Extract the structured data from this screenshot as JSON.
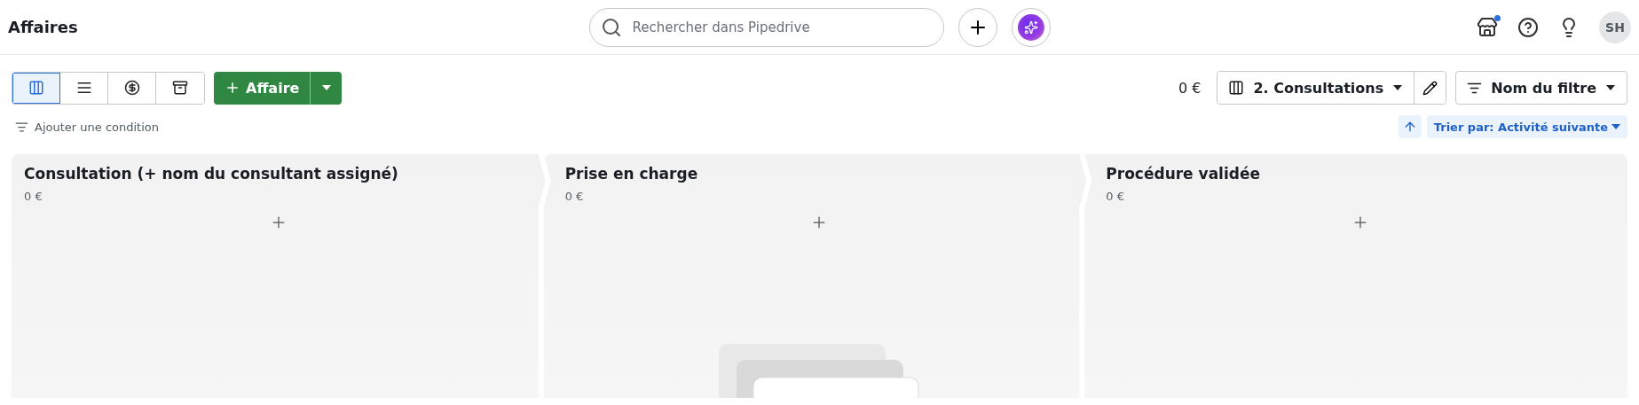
{
  "header": {
    "title": "Affaires",
    "search": {
      "placeholder": "Rechercher dans Pipedrive"
    },
    "marketplace_notification": true,
    "avatar": "SH"
  },
  "toolbar": {
    "views": [
      {
        "kind": "kanban",
        "selected": true
      },
      {
        "kind": "list",
        "selected": false
      },
      {
        "kind": "forecast",
        "selected": false
      },
      {
        "kind": "archive",
        "selected": false
      }
    ],
    "add_button": "Affaire",
    "total": "0 €",
    "pipeline": "2. Consultations",
    "filter": "Nom du filtre"
  },
  "condition_link": "Ajouter une condition",
  "sort": {
    "label": "Trier par: Activité suivante"
  },
  "stages": [
    {
      "name": "Consultation (+ nom du consultant assigné)",
      "amount": "0 €"
    },
    {
      "name": "Prise en charge",
      "amount": "0 €"
    },
    {
      "name": "Procédure validée",
      "amount": "0 €"
    }
  ]
}
